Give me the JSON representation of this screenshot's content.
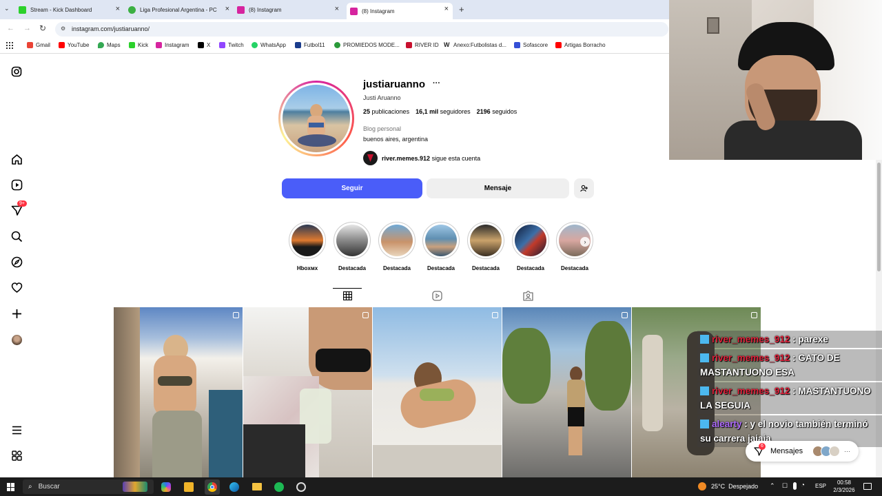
{
  "browser": {
    "tabs": [
      {
        "label": "Stream - Kick Dashboard",
        "color": "#2cd12c"
      },
      {
        "label": "Liga Profesional Argentina - PC",
        "color": "#3cb043"
      },
      {
        "label": "(8) Instagram",
        "color": "#d6249f"
      },
      {
        "label": "(8) Instagram",
        "color": "#d6249f"
      }
    ],
    "new_tab": "+",
    "url": "instagram.com/justiaruanno/",
    "bookmarks": [
      {
        "label": "Gmail",
        "color": "#ea4335"
      },
      {
        "label": "YouTube",
        "color": "#ff0000"
      },
      {
        "label": "Maps",
        "color": "#34a853"
      },
      {
        "label": "Kick",
        "color": "#2cd12c"
      },
      {
        "label": "Instagram",
        "color": "#d6249f"
      },
      {
        "label": "X",
        "color": "#000000"
      },
      {
        "label": "Twitch",
        "color": "#9146ff"
      },
      {
        "label": "WhatsApp",
        "color": "#25d366"
      },
      {
        "label": "Futbol11",
        "color": "#1a3c8c"
      },
      {
        "label": "PROMIEDOS MODE...",
        "color": "#2a9a3a"
      },
      {
        "label": "RIVER ID",
        "color": "#c8102e"
      },
      {
        "label": "Anexo:Futbolistas d...",
        "color": "#555555"
      },
      {
        "label": "Sofascore",
        "color": "#3550d6"
      },
      {
        "label": "Artigas Borracho",
        "color": "#ff0000"
      }
    ]
  },
  "sidebar": {
    "notifications_badge": "9+"
  },
  "profile": {
    "username": "justiaruanno",
    "more": "···",
    "full_name": "Justi Aruanno",
    "posts_count": "25",
    "posts_label": "publicaciones",
    "followers_count": "16,1 mil",
    "followers_label": "seguidores",
    "following_count": "2196",
    "following_label": "seguidos",
    "category": "Blog personal",
    "location": "buenos aires, argentina",
    "followed_by_user": "river.memes.912",
    "followed_by_text": "sigue esta cuenta",
    "follow_button": "Seguir",
    "message_button": "Mensaje"
  },
  "highlights": [
    {
      "label": "Hboxмx"
    },
    {
      "label": "Destacada"
    },
    {
      "label": "Destacada"
    },
    {
      "label": "Destacada"
    },
    {
      "label": "Destacada"
    },
    {
      "label": "Destacada"
    },
    {
      "label": "Destacada"
    }
  ],
  "chat": [
    {
      "user": "river_memes_912",
      "msg": " : parexe"
    },
    {
      "user": "river_memes_912",
      "msg": " : GATO DE MASTANTUONO ESA"
    },
    {
      "user": "river_memes_912",
      "msg": " : MASTANTUONO LA SEGUIA"
    },
    {
      "user": "alearty",
      "msg": " : y el novio también terminó su carrera jajaja"
    }
  ],
  "messages_pill": {
    "label": "Mensajes",
    "badge": "6",
    "more": "···"
  },
  "taskbar": {
    "search": "Buscar",
    "weather": "25°C  Despejado",
    "lang": "ESP",
    "time": "00:58",
    "date": "2/3/2026"
  }
}
